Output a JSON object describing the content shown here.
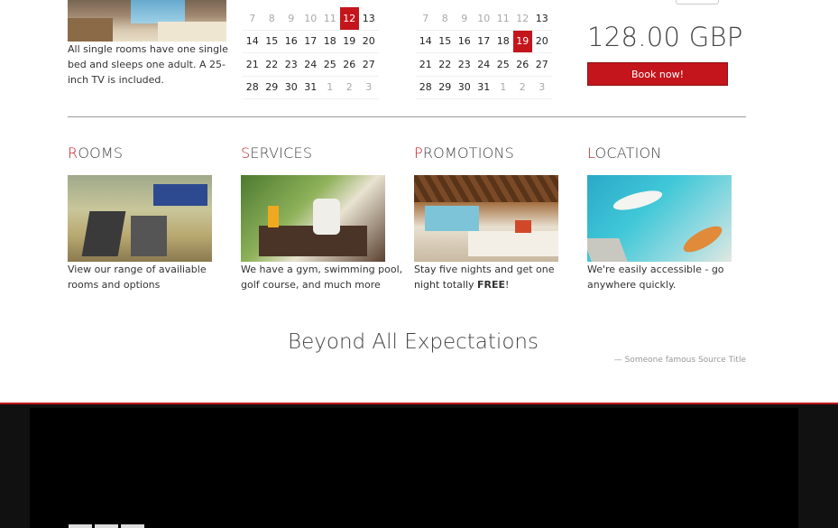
{
  "room": {
    "description": "All single rooms have one single bed and sleeps one adult. A 25-inch TV is included."
  },
  "calendar1": {
    "days": [
      "7",
      "8",
      "9",
      "10",
      "11",
      "12",
      "13",
      "14",
      "15",
      "16",
      "17",
      "18",
      "19",
      "20",
      "21",
      "22",
      "23",
      "24",
      "25",
      "26",
      "27",
      "28",
      "29",
      "30",
      "31",
      "1",
      "2",
      "3"
    ],
    "muted": [
      0,
      1,
      2,
      3,
      4,
      25,
      26,
      27
    ],
    "selected": "12"
  },
  "calendar2": {
    "days": [
      "7",
      "8",
      "9",
      "10",
      "11",
      "12",
      "13",
      "14",
      "15",
      "16",
      "17",
      "18",
      "19",
      "20",
      "21",
      "22",
      "23",
      "24",
      "25",
      "26",
      "27",
      "28",
      "29",
      "30",
      "31",
      "1",
      "2",
      "3"
    ],
    "muted": [
      0,
      1,
      2,
      3,
      4,
      5,
      25,
      26,
      27
    ],
    "selected": "19"
  },
  "booking": {
    "price": "128.00 GBP",
    "book_label": "Book now!"
  },
  "features": [
    {
      "first": "R",
      "rest": "OOMS",
      "text": "View our range of availiable rooms and options",
      "bold": ""
    },
    {
      "first": "S",
      "rest": "ERVICES",
      "text": "We have a gym, swimming pool, golf course, and much more",
      "bold": ""
    },
    {
      "first": "P",
      "rest": "ROMOTIONS",
      "text": "Stay five nights and get one night totally ",
      "bold": "FREE",
      "after": "!"
    },
    {
      "first": "L",
      "rest": "OCATION",
      "text": "We're easily accessible - go anywhere quickly.",
      "bold": ""
    }
  ],
  "quote": {
    "text": "Beyond All Expectations",
    "source": "— Someone famous Source Title"
  },
  "colors": {
    "accent": "#c4151c",
    "footer_bg": "#000000"
  }
}
